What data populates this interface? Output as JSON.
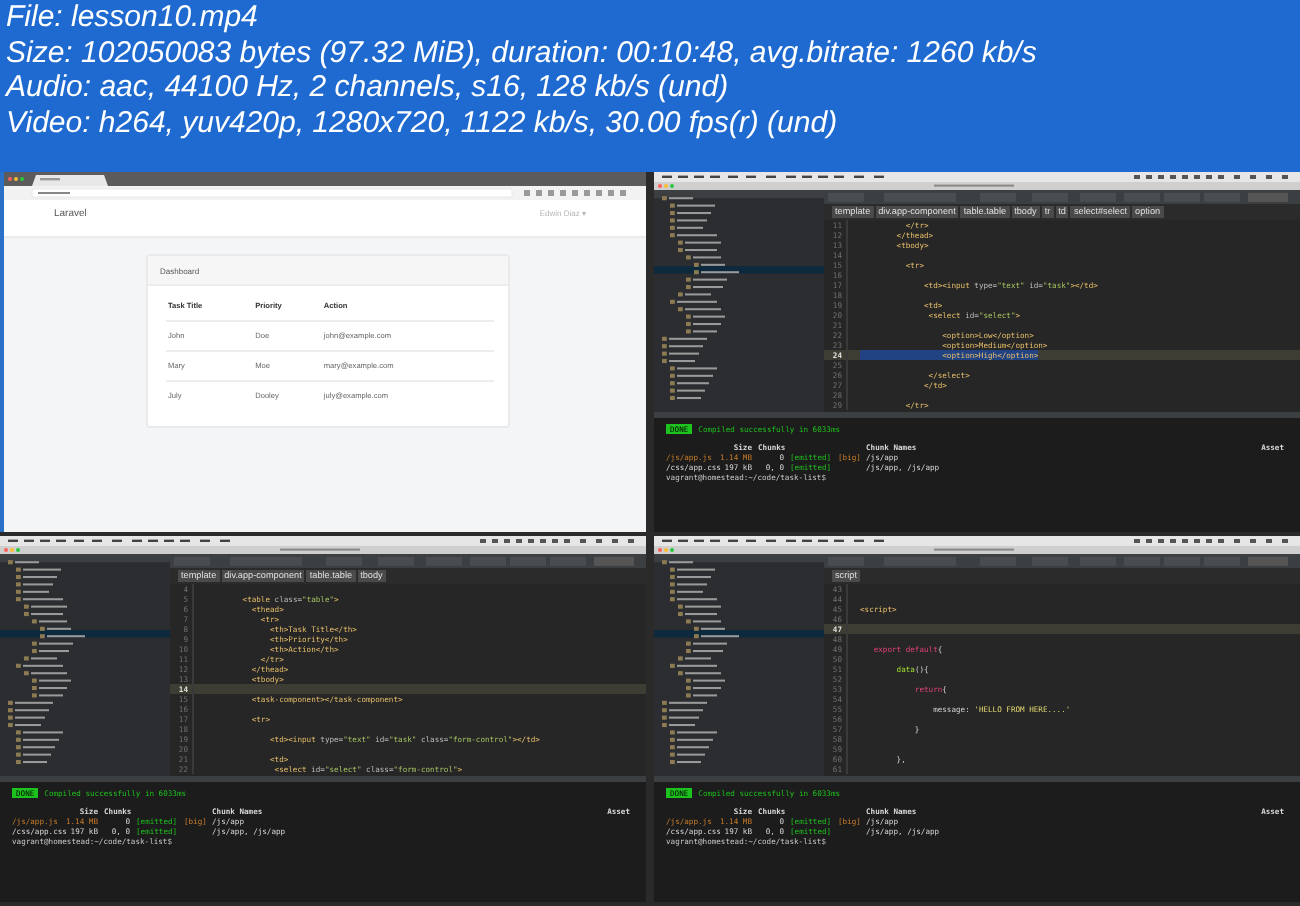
{
  "header": {
    "lines": [
      "File: lesson10.mp4",
      "Size: 102050083 bytes (97.32 MiB), duration: 00:10:48, avg.bitrate: 1260 kb/s",
      "Audio: aac, 44100 Hz, 2 channels, s16, 128 kb/s (und)",
      "Video: h264, yuv420p, 1280x720, 1122 kb/s, 30.00 fps(r) (und)"
    ]
  },
  "frames": [
    {
      "kind": "browser",
      "brand": "Laravel",
      "user_menu": "Edwin Diaz ▾",
      "card_title": "Dashboard",
      "table": {
        "columns": [
          "Task Title",
          "Priority",
          "Action"
        ],
        "rows": [
          [
            "John",
            "Doe",
            "john@example.com"
          ],
          [
            "Mary",
            "Moe",
            "mary@example.com"
          ],
          [
            "July",
            "Dooley",
            "july@example.com"
          ]
        ]
      }
    },
    {
      "kind": "ide",
      "breadcrumb": [
        "template",
        "div.app-component",
        "table.table",
        "tbody",
        "tr",
        "td",
        "select#select",
        "option"
      ],
      "lines": [
        {
          "n": "11",
          "current": false,
          "segs": [
            {
              "text": "          </tr>",
              "kind": "tag"
            }
          ]
        },
        {
          "n": "12",
          "current": false,
          "segs": [
            {
              "text": "        </thead>",
              "kind": "tag"
            }
          ]
        },
        {
          "n": "13",
          "current": false,
          "segs": [
            {
              "text": "        <tbody>",
              "kind": "tag"
            }
          ]
        },
        {
          "n": "14",
          "current": false
        },
        {
          "n": "15",
          "current": false,
          "segs": [
            {
              "text": "          <tr>",
              "kind": "tag"
            }
          ]
        },
        {
          "n": "16",
          "current": false
        },
        {
          "n": "17",
          "current": false,
          "segs": [
            {
              "text": "              <td><input",
              "kind": "tag"
            },
            {
              "text": " type=",
              "kind": "attr"
            },
            {
              "text": "\"text\"",
              "kind": "str"
            },
            {
              "text": " id=",
              "kind": "attr"
            },
            {
              "text": "\"task\"",
              "kind": "str"
            },
            {
              "text": "></td>",
              "kind": "tag"
            }
          ]
        },
        {
          "n": "18",
          "current": false
        },
        {
          "n": "19",
          "current": false,
          "segs": [
            {
              "text": "              <td>",
              "kind": "tag"
            }
          ]
        },
        {
          "n": "20",
          "current": false,
          "segs": [
            {
              "text": "               <select",
              "kind": "tag"
            },
            {
              "text": " id=",
              "kind": "attr"
            },
            {
              "text": "\"select\"",
              "kind": "str"
            },
            {
              "text": ">",
              "kind": "tag"
            }
          ]
        },
        {
          "n": "21",
          "current": false
        },
        {
          "n": "22",
          "current": false,
          "segs": [
            {
              "text": "                  <option>Low</option>",
              "kind": "tag"
            }
          ]
        },
        {
          "n": "23",
          "current": false,
          "segs": [
            {
              "text": "                  <option>Medium</option>",
              "kind": "tag"
            }
          ]
        },
        {
          "n": "24",
          "current": true,
          "segs": [
            {
              "text": "                  <option>High</option>",
              "kind": "sel"
            }
          ]
        },
        {
          "n": "25",
          "current": false
        },
        {
          "n": "26",
          "current": false,
          "segs": [
            {
              "text": "               </select>",
              "kind": "tag"
            }
          ]
        },
        {
          "n": "27",
          "current": false,
          "segs": [
            {
              "text": "              </td>",
              "kind": "tag"
            }
          ]
        },
        {
          "n": "28",
          "current": false
        },
        {
          "n": "29",
          "current": false,
          "segs": [
            {
              "text": "          </tr>",
              "kind": "tag"
            }
          ]
        }
      ],
      "terminal": {
        "badge": "DONE",
        "message": "Compiled successfully in 6033ms",
        "columns": {
          "size": "Size",
          "chunks": "Chunks",
          "names": "Chunk Names",
          "asset": "Asset"
        },
        "rows": [
          {
            "big": true,
            "asset": "/js/app.js",
            "size": "1.14 MB",
            "chunks": "0",
            "status": "[emitted]",
            "flag": "[big]",
            "names": "/js/app"
          },
          {
            "big": false,
            "asset": "/css/app.css",
            "size": "197 kB",
            "chunks": "0, 0",
            "status": "[emitted]",
            "names": "/js/app, /js/app"
          }
        ],
        "prompt": "vagrant@homestead:~/code/task-list$"
      }
    },
    {
      "kind": "ide",
      "breadcrumb": [
        "template",
        "div.app-component",
        "table.table",
        "tbody"
      ],
      "lines": [
        {
          "n": "4",
          "current": false
        },
        {
          "n": "5",
          "current": false,
          "segs": [
            {
              "text": "        <table",
              "kind": "tag"
            },
            {
              "text": " class=",
              "kind": "attr"
            },
            {
              "text": "\"table\"",
              "kind": "str"
            },
            {
              "text": ">",
              "kind": "tag"
            }
          ]
        },
        {
          "n": "6",
          "current": false,
          "segs": [
            {
              "text": "          <thead>",
              "kind": "tag"
            }
          ]
        },
        {
          "n": "7",
          "current": false,
          "segs": [
            {
              "text": "            <tr>",
              "kind": "tag"
            }
          ]
        },
        {
          "n": "8",
          "current": false,
          "segs": [
            {
              "text": "              <th>Task Title</th>",
              "kind": "tag"
            }
          ]
        },
        {
          "n": "9",
          "current": false,
          "segs": [
            {
              "text": "              <th>Priority</th>",
              "kind": "tag"
            }
          ]
        },
        {
          "n": "10",
          "current": false,
          "segs": [
            {
              "text": "              <th>Action</th>",
              "kind": "tag"
            }
          ]
        },
        {
          "n": "11",
          "current": false,
          "segs": [
            {
              "text": "            </tr>",
              "kind": "tag"
            }
          ]
        },
        {
          "n": "12",
          "current": false,
          "segs": [
            {
              "text": "          </thead>",
              "kind": "tag"
            }
          ]
        },
        {
          "n": "13",
          "current": false,
          "segs": [
            {
              "text": "          <tbody>",
              "kind": "tag"
            }
          ]
        },
        {
          "n": "14",
          "current": true
        },
        {
          "n": "15",
          "current": false,
          "segs": [
            {
              "text": "          <task-component></task-component>",
              "kind": "tag"
            }
          ]
        },
        {
          "n": "16",
          "current": false
        },
        {
          "n": "17",
          "current": false,
          "segs": [
            {
              "text": "          <tr>",
              "kind": "tag"
            }
          ]
        },
        {
          "n": "18",
          "current": false
        },
        {
          "n": "19",
          "current": false,
          "segs": [
            {
              "text": "              <td><input",
              "kind": "tag"
            },
            {
              "text": " type=",
              "kind": "attr"
            },
            {
              "text": "\"text\"",
              "kind": "str"
            },
            {
              "text": " id=",
              "kind": "attr"
            },
            {
              "text": "\"task\"",
              "kind": "str"
            },
            {
              "text": " class=",
              "kind": "attr"
            },
            {
              "text": "\"form-control\"",
              "kind": "str"
            },
            {
              "text": "></td>",
              "kind": "tag"
            }
          ]
        },
        {
          "n": "20",
          "current": false
        },
        {
          "n": "21",
          "current": false,
          "segs": [
            {
              "text": "              <td>",
              "kind": "tag"
            }
          ]
        },
        {
          "n": "22",
          "current": false,
          "segs": [
            {
              "text": "               <select",
              "kind": "tag"
            },
            {
              "text": " id=",
              "kind": "attr"
            },
            {
              "text": "\"select\"",
              "kind": "str"
            },
            {
              "text": " class=",
              "kind": "attr"
            },
            {
              "text": "\"form-control\"",
              "kind": "str"
            },
            {
              "text": ">",
              "kind": "tag"
            }
          ]
        }
      ],
      "terminal": {
        "badge": "DONE",
        "message": "Compiled successfully in 6033ms",
        "columns": {
          "size": "Size",
          "chunks": "Chunks",
          "names": "Chunk Names",
          "asset": "Asset"
        },
        "rows": [
          {
            "big": true,
            "asset": "/js/app.js",
            "size": "1.14 MB",
            "chunks": "0",
            "status": "[emitted]",
            "flag": "[big]",
            "names": "/js/app"
          },
          {
            "big": false,
            "asset": "/css/app.css",
            "size": "197 kB",
            "chunks": "0, 0",
            "status": "[emitted]",
            "names": "/js/app, /js/app"
          }
        ],
        "prompt": "vagrant@homestead:~/code/task-list$"
      }
    },
    {
      "kind": "ide",
      "breadcrumb": [
        "script"
      ],
      "lines": [
        {
          "n": "43",
          "current": false
        },
        {
          "n": "44",
          "current": false
        },
        {
          "n": "45",
          "current": false,
          "segs": [
            {
              "text": "<script>",
              "kind": "tag"
            }
          ]
        },
        {
          "n": "46",
          "current": false
        },
        {
          "n": "47",
          "current": true
        },
        {
          "n": "48",
          "current": false
        },
        {
          "n": "49",
          "current": false,
          "segs": [
            {
              "text": "   export default",
              "kind": "kw"
            },
            {
              "text": "{",
              "kind": "plain"
            }
          ]
        },
        {
          "n": "50",
          "current": false
        },
        {
          "n": "51",
          "current": false,
          "segs": [
            {
              "text": "        data",
              "kind": "fn"
            },
            {
              "text": "(){",
              "kind": "plain"
            }
          ]
        },
        {
          "n": "52",
          "current": false
        },
        {
          "n": "53",
          "current": false,
          "segs": [
            {
              "text": "            return",
              "kind": "kw"
            },
            {
              "text": "{",
              "kind": "plain"
            }
          ]
        },
        {
          "n": "54",
          "current": false
        },
        {
          "n": "55",
          "current": false,
          "segs": [
            {
              "text": "                message: ",
              "kind": "plain"
            },
            {
              "text": "'HELLO FROM HERE....'",
              "kind": "lit"
            }
          ]
        },
        {
          "n": "56",
          "current": false
        },
        {
          "n": "57",
          "current": false,
          "segs": [
            {
              "text": "            }",
              "kind": "plain"
            }
          ]
        },
        {
          "n": "58",
          "current": false
        },
        {
          "n": "59",
          "current": false
        },
        {
          "n": "60",
          "current": false,
          "segs": [
            {
              "text": "        },",
              "kind": "plain"
            }
          ]
        },
        {
          "n": "61",
          "current": false
        }
      ],
      "terminal": {
        "badge": "DONE",
        "message": "Compiled successfully in 6033ms",
        "columns": {
          "size": "Size",
          "chunks": "Chunks",
          "names": "Chunk Names",
          "asset": "Asset"
        },
        "rows": [
          {
            "big": true,
            "asset": "/js/app.js",
            "size": "1.14 MB",
            "chunks": "0",
            "status": "[emitted]",
            "flag": "[big]",
            "names": "/js/app"
          },
          {
            "big": false,
            "asset": "/css/app.css",
            "size": "197 kB",
            "chunks": "0, 0",
            "status": "[emitted]",
            "names": "/js/app, /js/app"
          }
        ],
        "prompt": "vagrant@homestead:~/code/task-list$"
      }
    }
  ]
}
